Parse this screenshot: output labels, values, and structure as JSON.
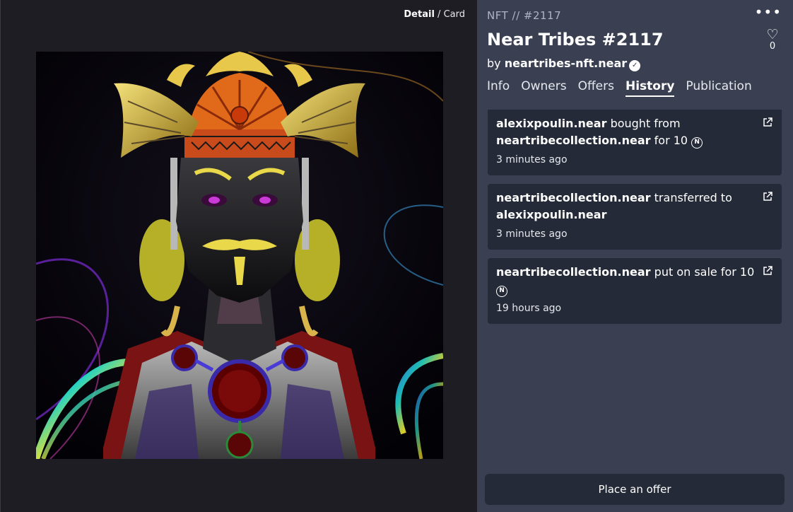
{
  "view_toggle": {
    "detail": "Detail",
    "separator": "/",
    "card": "Card"
  },
  "nft": {
    "id_label": "NFT // #2117",
    "title": "Near Tribes #2117",
    "by": "by",
    "creator": "neartribes-nft.near",
    "likes": "0"
  },
  "tabs": [
    "Info",
    "Owners",
    "Offers",
    "History",
    "Publication"
  ],
  "history": [
    {
      "actor": "alexixpoulin.near",
      "action": "bought from",
      "target": "neartribecollection.near",
      "suffix": "for 10",
      "time": "3 minutes ago"
    },
    {
      "actor": "neartribecollection.near",
      "action": "transferred to",
      "target": "alexixpoulin.near",
      "suffix": "",
      "time": "3 minutes ago"
    },
    {
      "actor": "neartribecollection.near",
      "action": "put on sale for 10",
      "target": "",
      "suffix": "",
      "time": "19 hours ago"
    }
  ],
  "actions": {
    "place_offer": "Place an offer"
  },
  "colors": {
    "left_bg": "#1f1d24",
    "right_bg": "#3a4052",
    "card_bg": "#242a38"
  },
  "icons": {
    "near": "near-icon",
    "verified": "verified-badge-icon",
    "external": "external-link-icon",
    "heart": "heart-icon",
    "more": "more-dots-icon"
  }
}
